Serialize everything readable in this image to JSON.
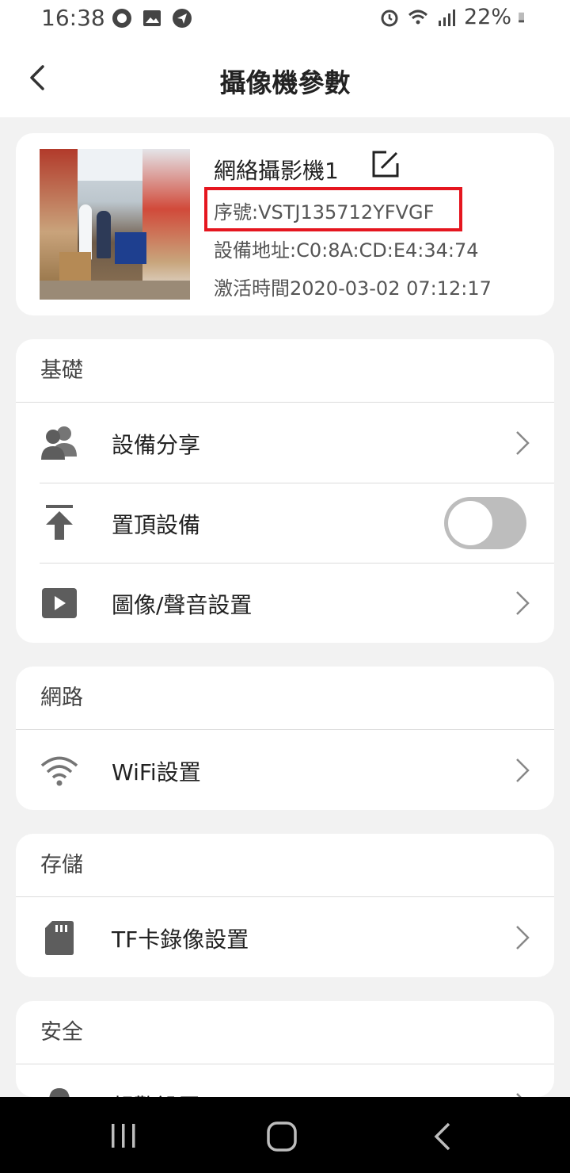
{
  "status_bar": {
    "time": "16:38",
    "battery": "22%",
    "icons_left": [
      "chat-badge-icon",
      "image-icon",
      "send-icon"
    ],
    "icons_right": [
      "alarm-icon",
      "wifi-icon",
      "signal-icon",
      "battery-icon"
    ]
  },
  "header": {
    "title": "攝像機參數",
    "back_icon": "chevron-left-icon"
  },
  "device": {
    "name": "網絡攝影機1",
    "serial": "序號:VSTJ135712YFVGF",
    "mac": "設備地址:C0:8A:CD:E4:34:74",
    "activation": "激活時間2020-03-02 07:12:17",
    "highlight_color": "#e5161f"
  },
  "sections": {
    "basic": {
      "title": "基礎",
      "items": [
        {
          "label": "設備分享",
          "icon": "people-icon"
        },
        {
          "label": "置頂設備",
          "icon": "pin-top-icon",
          "toggle": false
        },
        {
          "label": "圖像/聲音設置",
          "icon": "video-play-icon"
        }
      ]
    },
    "network": {
      "title": "網路",
      "items": [
        {
          "label": "WiFi設置",
          "icon": "wifi-icon"
        }
      ]
    },
    "storage": {
      "title": "存儲",
      "items": [
        {
          "label": "TF卡錄像設置",
          "icon": "sd-card-icon"
        }
      ]
    },
    "security": {
      "title": "安全",
      "items": [
        {
          "label": "報警設置",
          "icon": "alarm-bell-icon"
        }
      ]
    }
  },
  "nav_bar": {
    "buttons": [
      "recent-apps-icon",
      "home-icon",
      "back-icon"
    ]
  }
}
